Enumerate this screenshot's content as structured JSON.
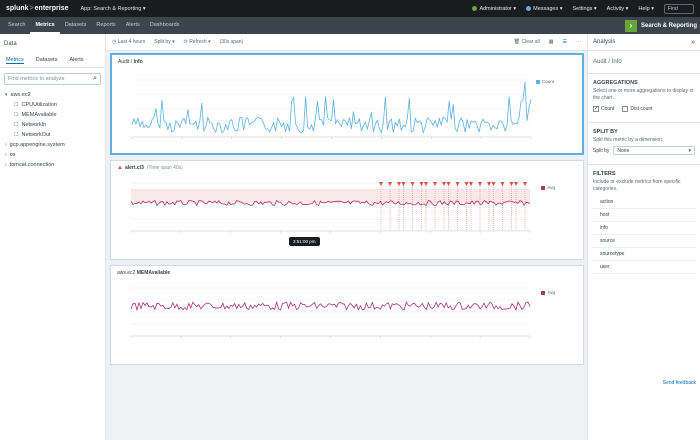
{
  "topbar": {
    "logo_brand": "splunk",
    "logo_gt": ">",
    "logo_product": "enterprise",
    "app_menu": "App: Search & Reporting ▾",
    "user": "Administrator ▾",
    "messages": "Messages ▾",
    "settings": "Settings ▾",
    "activity": "Activity ▾",
    "help": "Help ▾",
    "find": "Find",
    "user_dot_color": "#65a637",
    "messages_dot_color": "#5db1e4"
  },
  "nav": {
    "tabs": [
      "Search",
      "Metrics",
      "Datasets",
      "Reports",
      "Alerts",
      "Dashboards"
    ],
    "active_index": 1,
    "app_title": "Search & Reporting"
  },
  "left": {
    "header": "Data",
    "tabs": [
      "Metrics",
      "Datasets",
      "Alerts"
    ],
    "search_placeholder": "Find metrics to analyze",
    "tree": [
      {
        "label": "aws.ec2",
        "level": 0,
        "icon": "▾"
      },
      {
        "label": "CPUUtilization",
        "level": 1,
        "icon": "☐"
      },
      {
        "label": "MEMAvailable",
        "level": 1,
        "icon": "☐"
      },
      {
        "label": "NetworkIn",
        "level": 1,
        "icon": "☐"
      },
      {
        "label": "NetworkOut",
        "level": 1,
        "icon": "☐"
      },
      {
        "label": "gcp.appengine.system",
        "level": 0,
        "icon": "›"
      },
      {
        "label": "os",
        "level": 0,
        "icon": "›"
      },
      {
        "label": "tomcat.connection",
        "level": 0,
        "icon": "›"
      }
    ]
  },
  "toolbar": {
    "time_range": "Last 4 hours",
    "split_by": "Split by ▾",
    "refresh": "Refresh ▾",
    "span": "(30s span)",
    "clear_all": "Clear all",
    "more": "···"
  },
  "panels": [
    {
      "name": "audit",
      "title": "Audit",
      "title_sep": " / ",
      "metric": "Info",
      "legend": "Count",
      "color": "#5db1e4",
      "selected": true
    },
    {
      "name": "alert",
      "title": "alert.cl3",
      "metric": "",
      "subtitle": "(Time span 40s)",
      "legend": "Avg",
      "color": "#a8356b",
      "selected": false
    },
    {
      "name": "mem",
      "title": "aws.ec2",
      "title_sep": " ",
      "metric": "MEMAvailable",
      "legend": "Avg",
      "color": "#a8356b",
      "selected": false
    }
  ],
  "tooltip_text": "3:51:00 pm",
  "right": {
    "header": "Analysis",
    "metric_title": "Audit / Info",
    "aggregations": {
      "title": "AGGREGATIONS",
      "desc": "Select one or more aggregations to display in the chart.",
      "options": [
        {
          "label": "Count",
          "checked": true
        },
        {
          "label": "Dist count",
          "checked": false
        }
      ]
    },
    "split": {
      "title": "SPLIT BY",
      "desc": "Split this metric by a dimension.",
      "label": "Split by",
      "value": "None"
    },
    "filters": {
      "title": "FILTERS",
      "desc": "Include or exclude metrics from specific categories.",
      "items": [
        "action",
        "host",
        "info",
        "source",
        "sourcetype",
        "user"
      ]
    },
    "feedback": "Send feedback"
  }
}
